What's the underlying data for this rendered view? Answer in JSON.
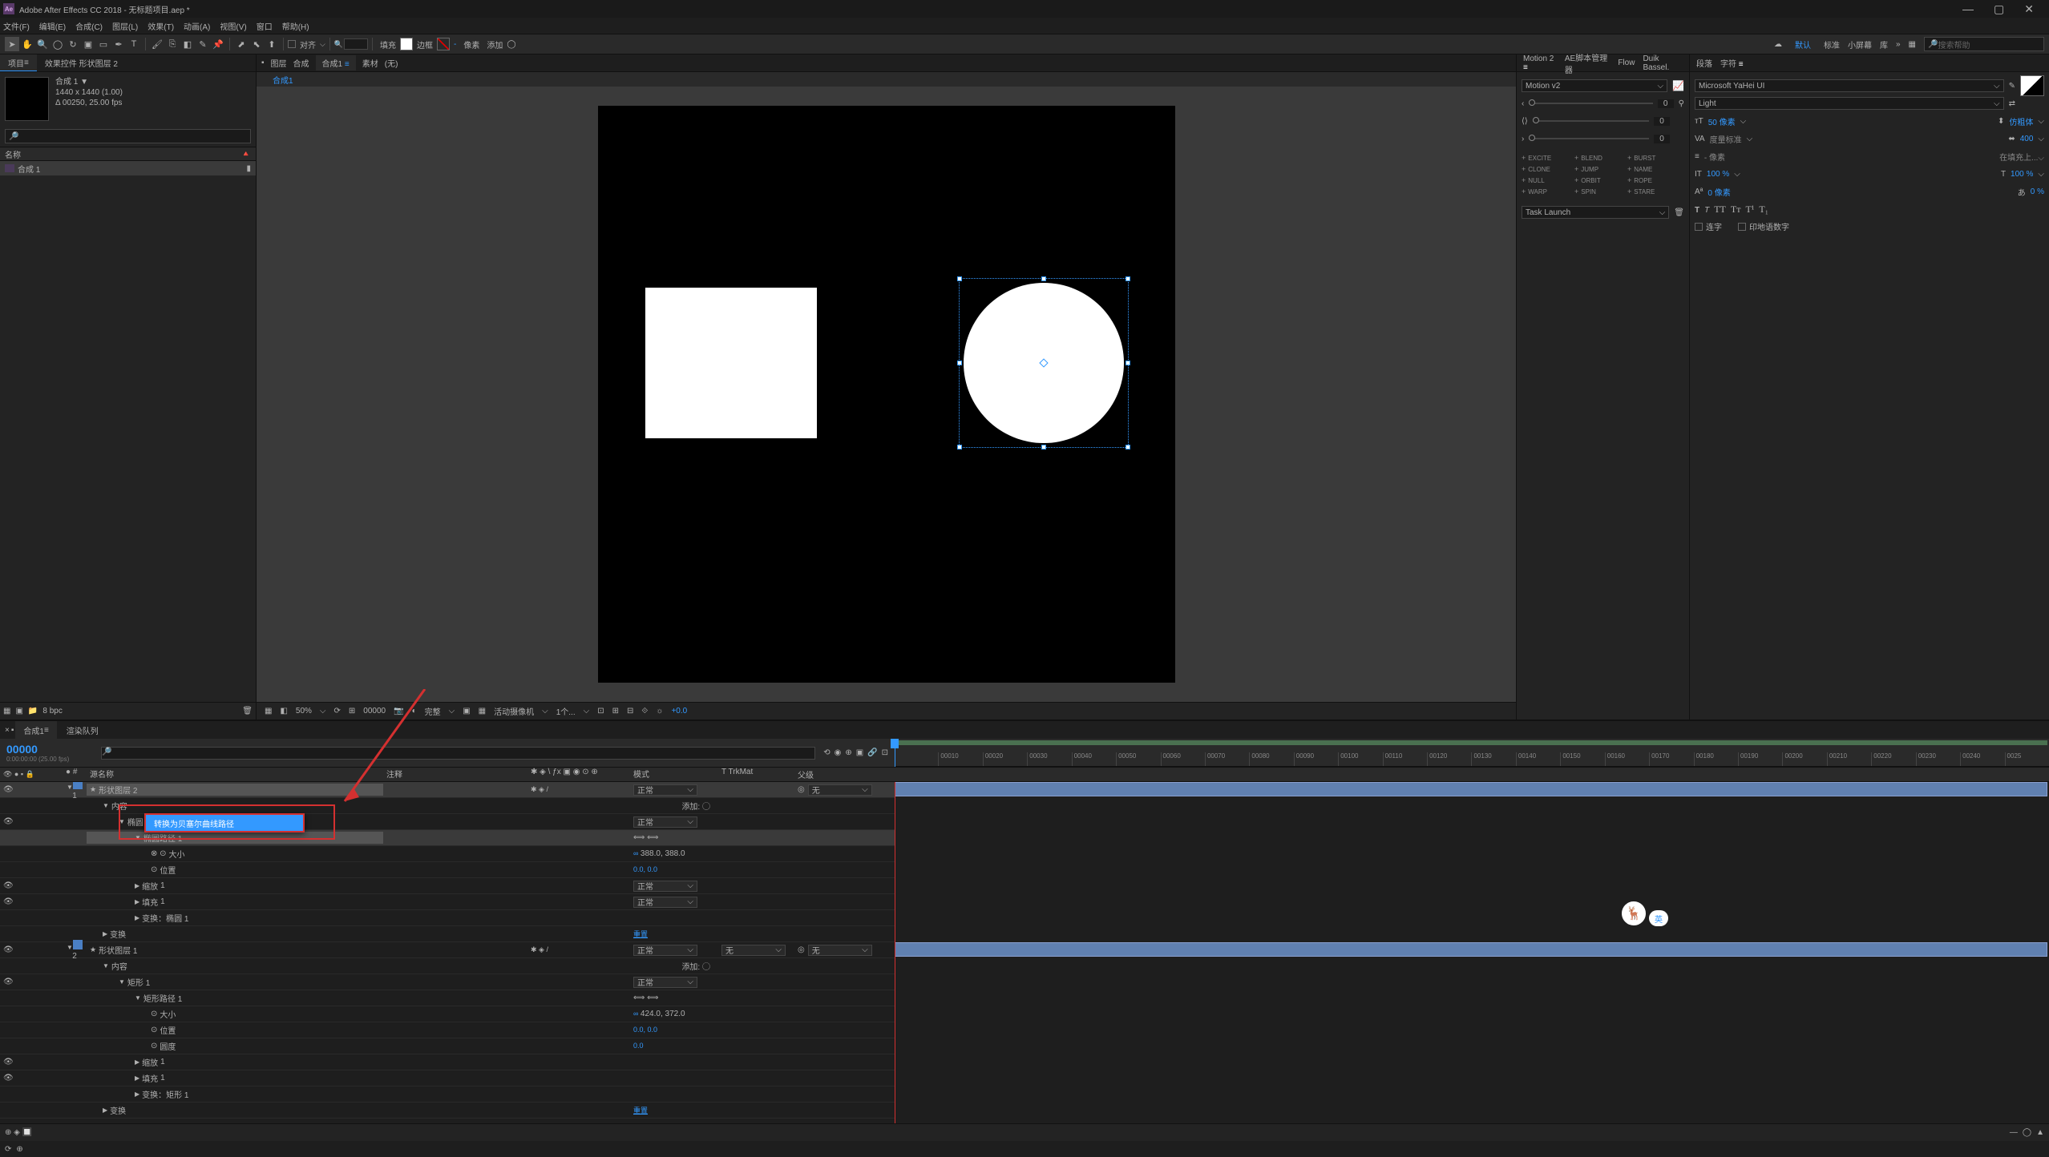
{
  "titlebar": {
    "app_icon_text": "Ae",
    "title": "Adobe After Effects CC 2018 - 无标题项目.aep *"
  },
  "menu": {
    "file": "文件(F)",
    "edit": "编辑(E)",
    "composition": "合成(C)",
    "layer": "图层(L)",
    "effect": "效果(T)",
    "animation": "动画(A)",
    "view": "视图(V)",
    "window": "窗口",
    "help": "帮助(H)"
  },
  "toolbar": {
    "snap": "对齐",
    "fill": "填充",
    "stroke": "边框",
    "stroke_px": "像素",
    "add": "添加",
    "workspace_default": "默认",
    "ws_standard": "标准",
    "ws_small": "小屏幕",
    "ws_lib": "库",
    "search_placeholder": "搜索帮助"
  },
  "project_panel": {
    "tab_project": "项目",
    "tab_effects": "效果控件 形状图层 2",
    "comp_name": "合成 1",
    "dimensions": "1440 x 1440 (1.00)",
    "duration": "Δ 00250, 25.00 fps",
    "column_name": "名称",
    "item1": "合成 1",
    "footer_bpc": "8 bpc"
  },
  "viewer": {
    "tab_layer": "图层",
    "tab_comp": "合成",
    "tab_comp_active": "合成1",
    "tab_footage": "素材",
    "tab_none": "(无)",
    "subtab": "合成1",
    "zoom": "50%",
    "timecode": "00000",
    "quality": "完整",
    "camera": "活动摄像机",
    "views": "1个...",
    "offset": "+0.0"
  },
  "right": {
    "motion_tab": "Motion 2",
    "script_tab": "AE脚本管理器",
    "flow_tab": "Flow",
    "duik_tab": "Duik Bassel.",
    "motion_dropdown": "Motion v2",
    "slider_val": "0",
    "btn_excite": "EXCITE",
    "btn_blend": "BLEND",
    "btn_burst": "BURST",
    "btn_clone": "CLONE",
    "btn_jump": "JUMP",
    "btn_name": "NAME",
    "btn_null": "NULL",
    "btn_orbit": "ORBIT",
    "btn_rope": "ROPE",
    "btn_warp": "WARP",
    "btn_spin": "SPIN",
    "btn_stare": "STARE",
    "task_launch": "Task Launch",
    "para_tab": "段落",
    "char_tab": "字符",
    "font_name": "Microsoft YaHei UI",
    "font_style": "Light",
    "size_val": "50 像素",
    "leading": "仿粗体",
    "tracking": "400",
    "scale_v": "100 %",
    "scale_h": "100 %",
    "baseline": "0 像素",
    "tsume": "0 %",
    "cb_ligature": "连字",
    "cb_hindi": "印地语数字"
  },
  "timeline": {
    "tab_comp": "合成1",
    "tab_render": "渲染队列",
    "timecode": "00000",
    "timecode_sub": "0:00:00:00 (25.00 fps)",
    "col_source": "源名称",
    "col_comment": "注释",
    "col_mode": "模式",
    "col_trkmat": "T  TrkMat",
    "col_parent": "父级",
    "layer1_name": "形状图层 2",
    "layer2_name": "形状图层 1",
    "prop_contents": "内容",
    "prop_ellipse": "椭圆 1",
    "prop_ellipse_path": "椭圆路径 1",
    "prop_position": "位置",
    "prop_scale": "缩放",
    "prop_fill": "填充",
    "prop_transform_ellipse": "变换：椭圆 1",
    "prop_transform": "变换",
    "prop_rect": "矩形 1",
    "prop_rect_path": "矩形路径 1",
    "prop_size": "大小",
    "prop_round": "圆度",
    "prop_transform_rect": "变换：矩形 1",
    "add_label": "添加:",
    "reset": "重置",
    "mode_normal": "正常",
    "parent_none": "无",
    "val_pos": "388.0, 388.0",
    "val_scale": "0.0, 0.0",
    "val_size2": "424.0, 372.0",
    "val_pos2": "0.0, 0.0",
    "val_round": "0.0",
    "context_bezier": "转换为贝塞尔曲线路径",
    "ruler_ticks": [
      "00010",
      "00020",
      "00030",
      "00040",
      "00050",
      "00060",
      "00070",
      "00080",
      "00090",
      "00100",
      "00110",
      "00120",
      "00130",
      "00140",
      "00150",
      "00160",
      "00170",
      "00180",
      "00190",
      "00200",
      "00210",
      "00220",
      "00230",
      "00240",
      "0025"
    ]
  },
  "badge_lang": "英"
}
